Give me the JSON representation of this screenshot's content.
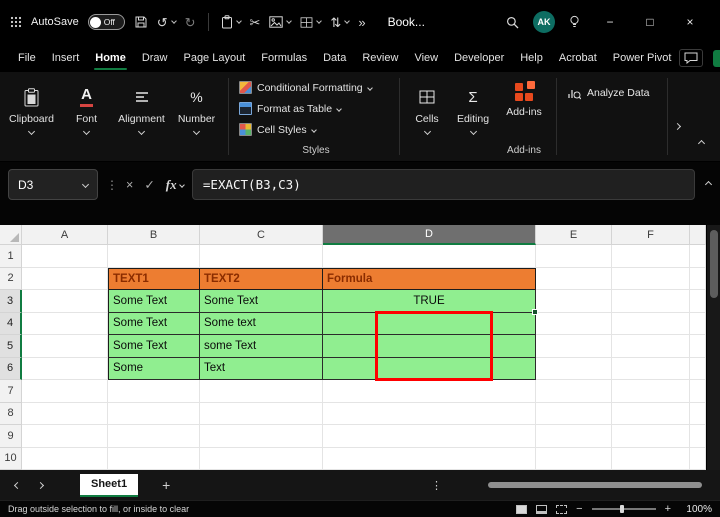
{
  "titlebar": {
    "autosave_label": "AutoSave",
    "autosave_state": "Off",
    "overflow_glyph": "»",
    "title": "Book...",
    "avatar_initials": "AK"
  },
  "menu": {
    "tabs": [
      "File",
      "Insert",
      "Home",
      "Draw",
      "Page Layout",
      "Formulas",
      "Data",
      "Review",
      "View",
      "Developer",
      "Help",
      "Acrobat",
      "Power Pivot"
    ],
    "active": "Home"
  },
  "ribbon": {
    "groups": [
      {
        "label": "Clipboard"
      },
      {
        "label": "Font"
      },
      {
        "label": "Alignment"
      },
      {
        "label": "Number"
      }
    ],
    "styles_items": [
      "Conditional Formatting",
      "Format as Table",
      "Cell Styles"
    ],
    "styles_label": "Styles",
    "cells_label": "Cells",
    "editing_label": "Editing",
    "addins_label": "Add-ins",
    "addins_group_label": "Add-ins",
    "analyze_label": "Analyze Data"
  },
  "formula_bar": {
    "name_box": "D3",
    "formula": "=EXACT(B3,C3)"
  },
  "grid": {
    "column_headers": [
      "A",
      "B",
      "C",
      "D",
      "E",
      "F"
    ],
    "selected_column": "D",
    "row_headers": [
      "1",
      "2",
      "3",
      "4",
      "5",
      "6",
      "7",
      "8",
      "9",
      "10"
    ],
    "selected_rows": [
      "3",
      "4",
      "5",
      "6"
    ],
    "cells": {
      "B2": "TEXT1",
      "C2": "TEXT2",
      "D2": "Formula",
      "B3": "Some Text",
      "C3": "Some Text",
      "D3": "TRUE",
      "B4": "Some Text",
      "C4": "Some text",
      "B5": "Some Text",
      "C5": "some Text",
      "B6": "Some",
      "C6": "Text"
    }
  },
  "sheet_bar": {
    "active_tab": "Sheet1"
  },
  "status_bar": {
    "message": "Drag outside selection to fill, or inside to clear",
    "zoom": "100%"
  },
  "colors": {
    "accent_green": "#107C41",
    "header_orange": "#ED7D31",
    "cell_green": "#90EE90",
    "annotation_red": "#FF0000"
  }
}
